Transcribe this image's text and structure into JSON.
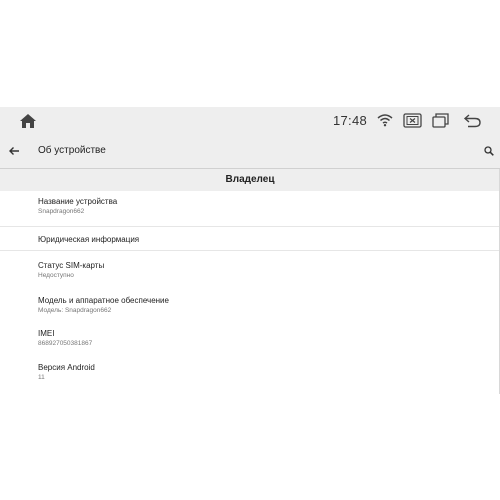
{
  "status_bar": {
    "time": "17:48",
    "icons": [
      "home-icon",
      "wifi-icon",
      "close-box-icon",
      "recents-icon",
      "back-arrow-icon"
    ]
  },
  "app_bar": {
    "title": "Об устройстве",
    "icons": [
      "back-icon",
      "search-icon"
    ]
  },
  "section_header": "Владелец",
  "items": [
    {
      "title": "Название устройства",
      "subtitle": "Snapdragon662"
    },
    {
      "title": "Юридическая информация",
      "subtitle": ""
    },
    {
      "title": "Статус SIM-карты",
      "subtitle": "Недоступно"
    },
    {
      "title": "Модель и аппаратное обеспечение",
      "subtitle": "Модель: Snapdragon662"
    },
    {
      "title": "IMEI",
      "subtitle": "868927050381867"
    },
    {
      "title": "Версия Android",
      "subtitle": "11"
    }
  ],
  "colors": {
    "bar_background": "#eeeeee",
    "page_background": "#ffffff",
    "text_primary": "#222222",
    "text_secondary": "#777777"
  }
}
